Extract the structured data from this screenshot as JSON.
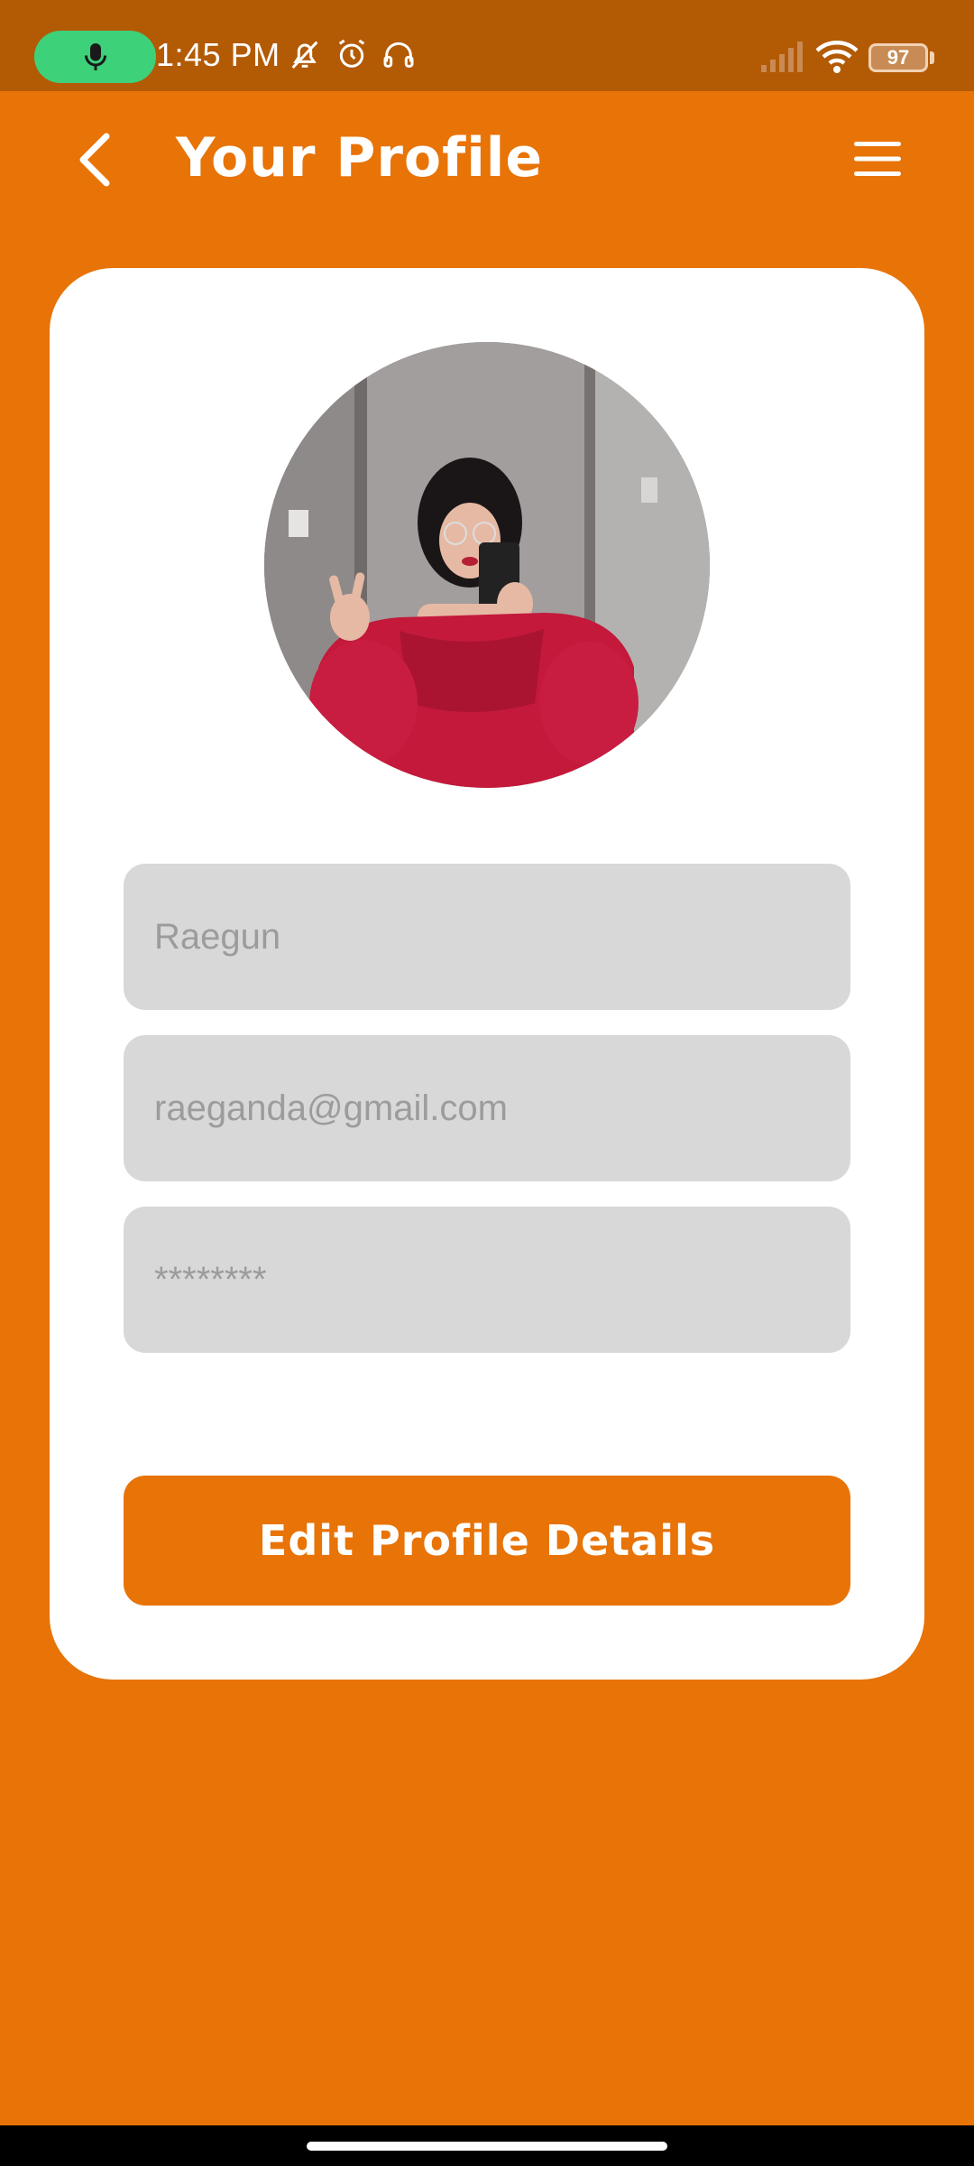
{
  "status_bar": {
    "time": "1:45 PM",
    "battery": "97",
    "icons": [
      "mic-icon",
      "bell-off-icon",
      "alarm-icon",
      "headset-icon",
      "signal-icon",
      "wifi-icon",
      "battery-icon"
    ]
  },
  "header": {
    "title": "Your Profile",
    "back_icon": "chevron-left-icon",
    "menu_icon": "hamburger-menu-icon"
  },
  "profile": {
    "avatar_alt": "profile photo",
    "name_value": "Raegun",
    "email_value": "raeganda@gmail.com",
    "password_value": "********"
  },
  "actions": {
    "edit_label": "Edit Profile Details"
  },
  "colors": {
    "accent": "#E87306",
    "status_bar": "#B35A05",
    "field_bg": "#D8D8D8",
    "field_text": "#9C9C9C",
    "card_bg": "#FFFFFF"
  }
}
